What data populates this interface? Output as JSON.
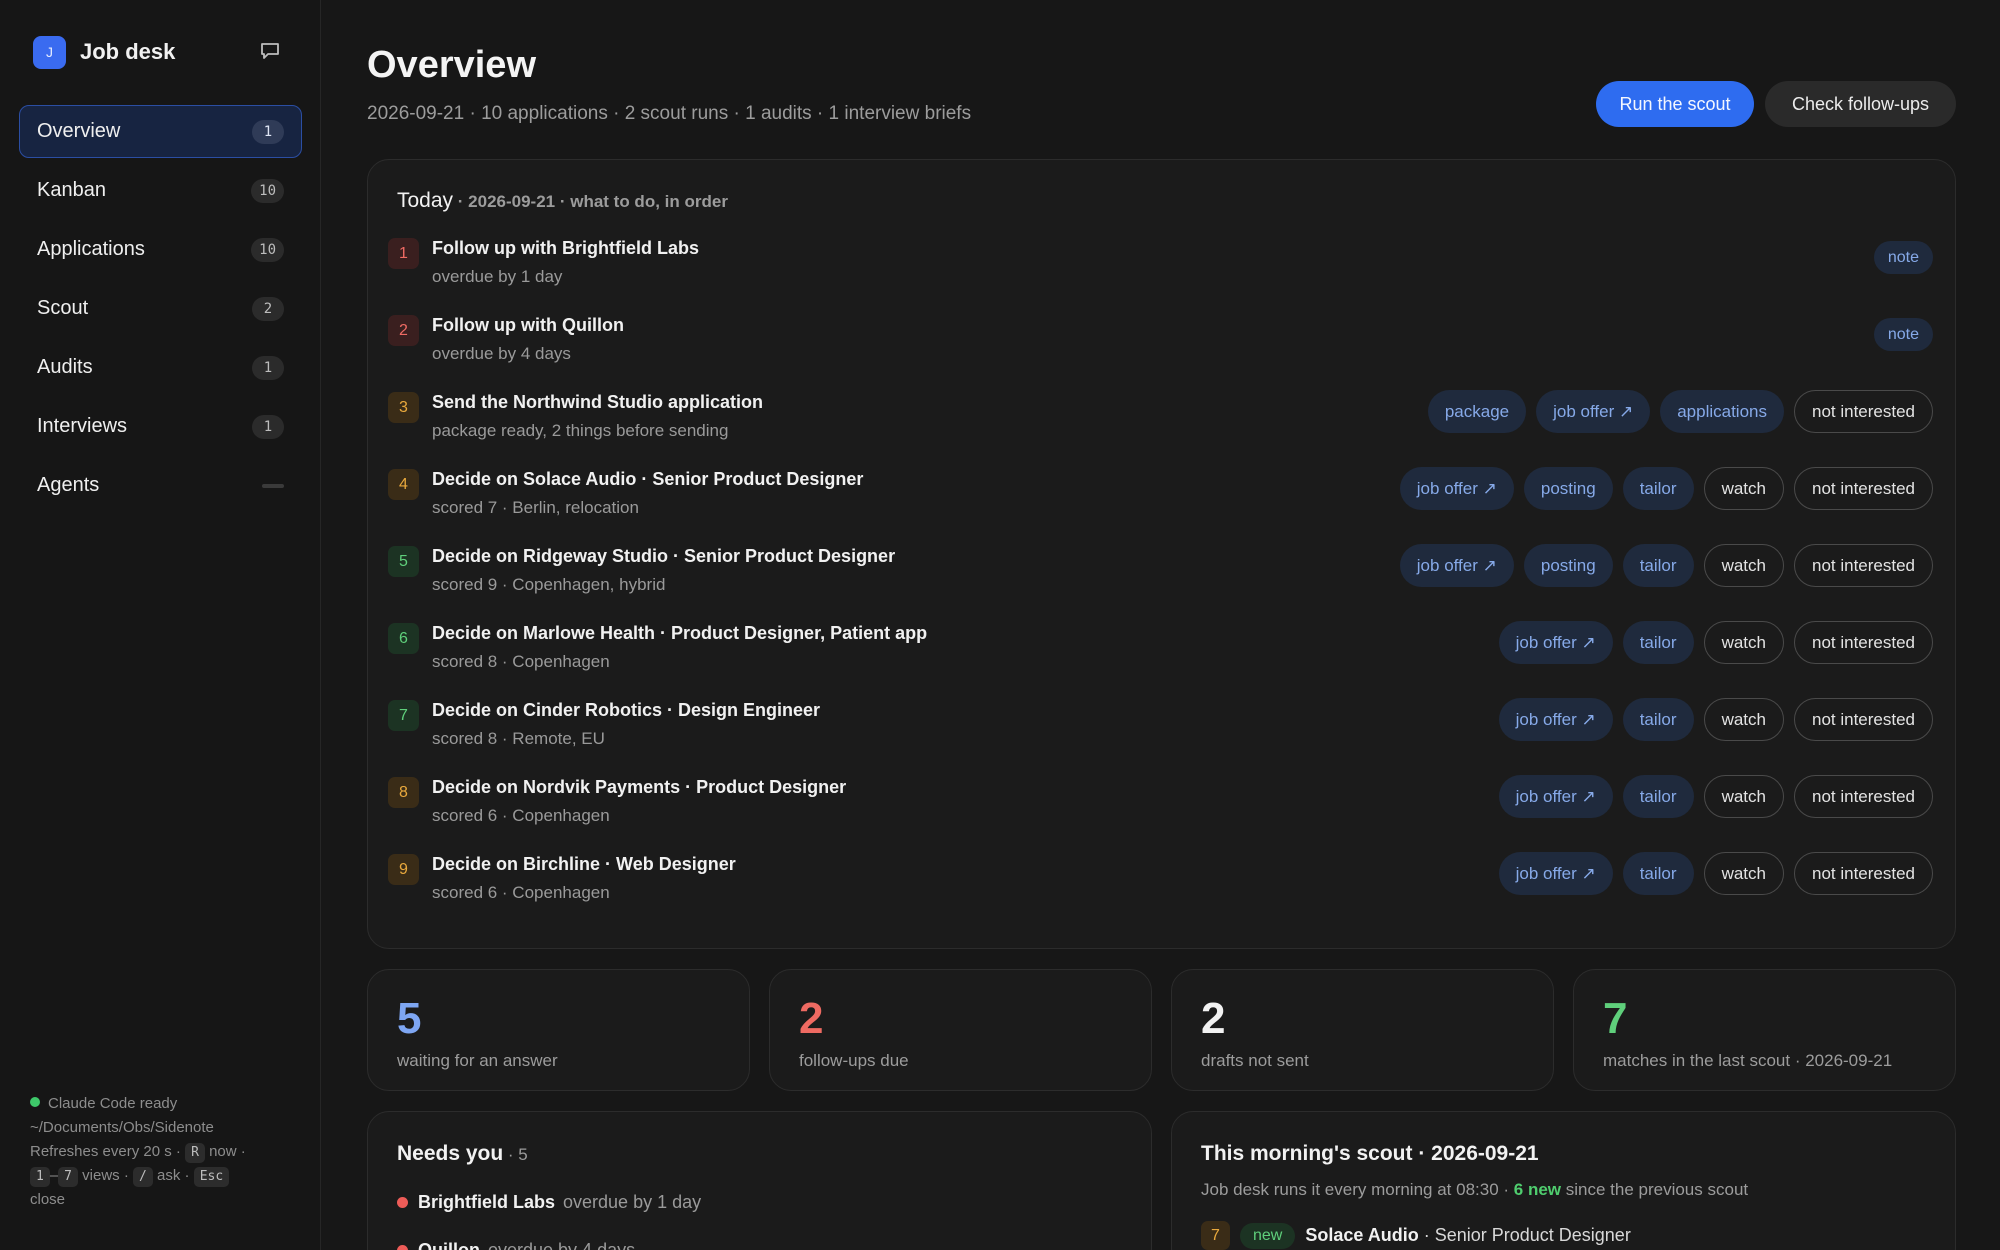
{
  "sidebar": {
    "brand_initial": "J",
    "brand_title": "Job desk",
    "items": [
      {
        "label": "Overview",
        "badge": "1",
        "active": true
      },
      {
        "label": "Kanban",
        "badge": "10"
      },
      {
        "label": "Applications",
        "badge": "10"
      },
      {
        "label": "Scout",
        "badge": "2"
      },
      {
        "label": "Audits",
        "badge": "1"
      },
      {
        "label": "Interviews",
        "badge": "1"
      },
      {
        "label": "Agents",
        "badge": ""
      }
    ],
    "footer": {
      "status": "Claude Code ready",
      "path": "~/Documents/Obs/Sidenote",
      "refresh": "Refreshes every 20 s ·",
      "refresh_key": "R",
      "refresh_now": "now ·",
      "views_key_a": "1",
      "views_dash": "–",
      "views_key_b": "7",
      "views_text": "views ·",
      "ask_key": "/",
      "ask_text": "ask ·",
      "close_key": "Esc",
      "close_text": "close"
    }
  },
  "header": {
    "title": "Overview",
    "subtitle": "2026-09-21 · 10 applications · 2 scout runs · 1 audits · 1 interview briefs",
    "run_scout": "Run the scout",
    "check_followups": "Check follow-ups"
  },
  "today": {
    "title": "Today",
    "meta": " · 2026-09-21 · what to do, in order",
    "tasks": [
      {
        "num": "1",
        "tone": "red",
        "title": "Follow up with Brightfield Labs",
        "sub": "overdue by 1 day",
        "actions": [
          {
            "label": "note",
            "kind": "tag-small"
          }
        ]
      },
      {
        "num": "2",
        "tone": "red",
        "title": "Follow up with Quillon",
        "sub": "overdue by 4 days",
        "actions": [
          {
            "label": "note",
            "kind": "tag-small"
          }
        ]
      },
      {
        "num": "3",
        "tone": "orange",
        "title": "Send the Northwind Studio application",
        "sub": "package ready, 2 things before sending",
        "actions": [
          {
            "label": "package",
            "kind": "tag"
          },
          {
            "label": "job offer ↗",
            "kind": "tag"
          },
          {
            "label": "applications",
            "kind": "tag"
          },
          {
            "label": "not interested",
            "kind": "outline"
          }
        ]
      },
      {
        "num": "4",
        "tone": "orange",
        "title": "Decide on Solace Audio · Senior Product Designer",
        "sub": "scored 7 · Berlin, relocation",
        "actions": [
          {
            "label": "job offer ↗",
            "kind": "tag"
          },
          {
            "label": "posting",
            "kind": "tag"
          },
          {
            "label": "tailor",
            "kind": "tag"
          },
          {
            "label": "watch",
            "kind": "outline"
          },
          {
            "label": "not interested",
            "kind": "outline"
          }
        ]
      },
      {
        "num": "5",
        "tone": "green",
        "title": "Decide on Ridgeway Studio · Senior Product Designer",
        "sub": "scored 9 · Copenhagen, hybrid",
        "actions": [
          {
            "label": "job offer ↗",
            "kind": "tag"
          },
          {
            "label": "posting",
            "kind": "tag"
          },
          {
            "label": "tailor",
            "kind": "tag"
          },
          {
            "label": "watch",
            "kind": "outline"
          },
          {
            "label": "not interested",
            "kind": "outline"
          }
        ]
      },
      {
        "num": "6",
        "tone": "green",
        "title": "Decide on Marlowe Health · Product Designer, Patient app",
        "sub": "scored 8 · Copenhagen",
        "actions": [
          {
            "label": "job offer ↗",
            "kind": "tag"
          },
          {
            "label": "tailor",
            "kind": "tag"
          },
          {
            "label": "watch",
            "kind": "outline"
          },
          {
            "label": "not interested",
            "kind": "outline"
          }
        ]
      },
      {
        "num": "7",
        "tone": "green",
        "title": "Decide on Cinder Robotics · Design Engineer",
        "sub": "scored 8 · Remote, EU",
        "actions": [
          {
            "label": "job offer ↗",
            "kind": "tag"
          },
          {
            "label": "tailor",
            "kind": "tag"
          },
          {
            "label": "watch",
            "kind": "outline"
          },
          {
            "label": "not interested",
            "kind": "outline"
          }
        ]
      },
      {
        "num": "8",
        "tone": "orange",
        "title": "Decide on Nordvik Payments · Product Designer",
        "sub": "scored 6 · Copenhagen",
        "actions": [
          {
            "label": "job offer ↗",
            "kind": "tag"
          },
          {
            "label": "tailor",
            "kind": "tag"
          },
          {
            "label": "watch",
            "kind": "outline"
          },
          {
            "label": "not interested",
            "kind": "outline"
          }
        ]
      },
      {
        "num": "9",
        "tone": "orange",
        "title": "Decide on Birchline · Web Designer",
        "sub": "scored 6 · Copenhagen",
        "actions": [
          {
            "label": "job offer ↗",
            "kind": "tag"
          },
          {
            "label": "tailor",
            "kind": "tag"
          },
          {
            "label": "watch",
            "kind": "outline"
          },
          {
            "label": "not interested",
            "kind": "outline"
          }
        ]
      }
    ]
  },
  "stats": [
    {
      "value": "5",
      "label": "waiting for an answer",
      "color": "#7ea6f2"
    },
    {
      "value": "2",
      "label": "follow-ups due",
      "color": "#ee6a62"
    },
    {
      "value": "2",
      "label": "drafts not sent",
      "color": "#f2f2f2"
    },
    {
      "value": "7",
      "label": "matches in the last scout · 2026-09-21",
      "color": "#5fcf7b"
    }
  ],
  "needs_you": {
    "title": "Needs you",
    "count": " · 5",
    "rows": [
      {
        "name": "Brightfield Labs",
        "sub": "overdue by 1 day"
      },
      {
        "name": "Quillon",
        "sub": "overdue by 4 days"
      }
    ]
  },
  "scout": {
    "title": "This morning's scout · 2026-09-21",
    "sub_a": "Job desk runs it every morning at 08:30 · ",
    "sub_new": "6 new",
    "sub_b": " since the previous scout",
    "first": {
      "score": "7",
      "tag": "new",
      "company": "Solace Audio",
      "role": " · Senior Product Designer"
    }
  }
}
